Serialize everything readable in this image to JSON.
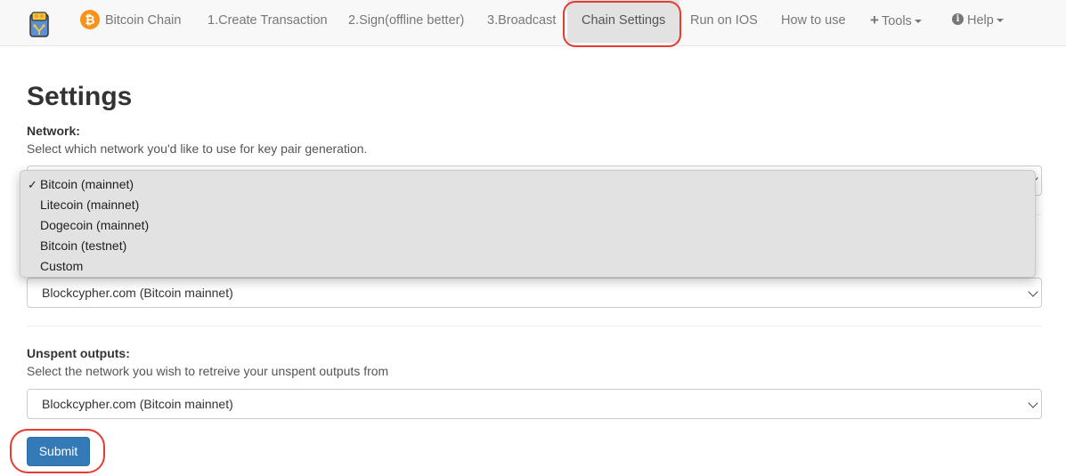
{
  "nav": {
    "brand": "Bitcoin Chain",
    "brand_icon": "bitcoin-icon",
    "brand_icon_glyph": "₿",
    "items": [
      {
        "label": "1.Create Transaction"
      },
      {
        "label": "2.Sign(offline better)"
      },
      {
        "label": "3.Broadcast"
      },
      {
        "label": "Chain Settings",
        "active": true
      },
      {
        "label": "Run on IOS"
      },
      {
        "label": "How to use"
      }
    ],
    "tools_label": "Tools",
    "help_label": "Help"
  },
  "page": {
    "title": "Settings"
  },
  "network": {
    "label": "Network:",
    "help": "Select which network you'd like to use for key pair generation.",
    "options": [
      "Bitcoin (mainnet)",
      "Litecoin (mainnet)",
      "Dogecoin (mainnet)",
      "Bitcoin (testnet)",
      "Custom"
    ],
    "selected_index": 0,
    "check_mark": "✓"
  },
  "broadcast": {
    "selected": "Blockcypher.com (Bitcoin mainnet)"
  },
  "unspent": {
    "label": "Unspent outputs:",
    "help": "Select the network you wish to retreive your unspent outputs from",
    "selected": "Blockcypher.com (Bitcoin mainnet)"
  },
  "submit_label": "Submit",
  "colors": {
    "accent": "#337ab7",
    "highlight_ring": "#e53c2e",
    "bitcoin_orange": "#f7931a"
  }
}
